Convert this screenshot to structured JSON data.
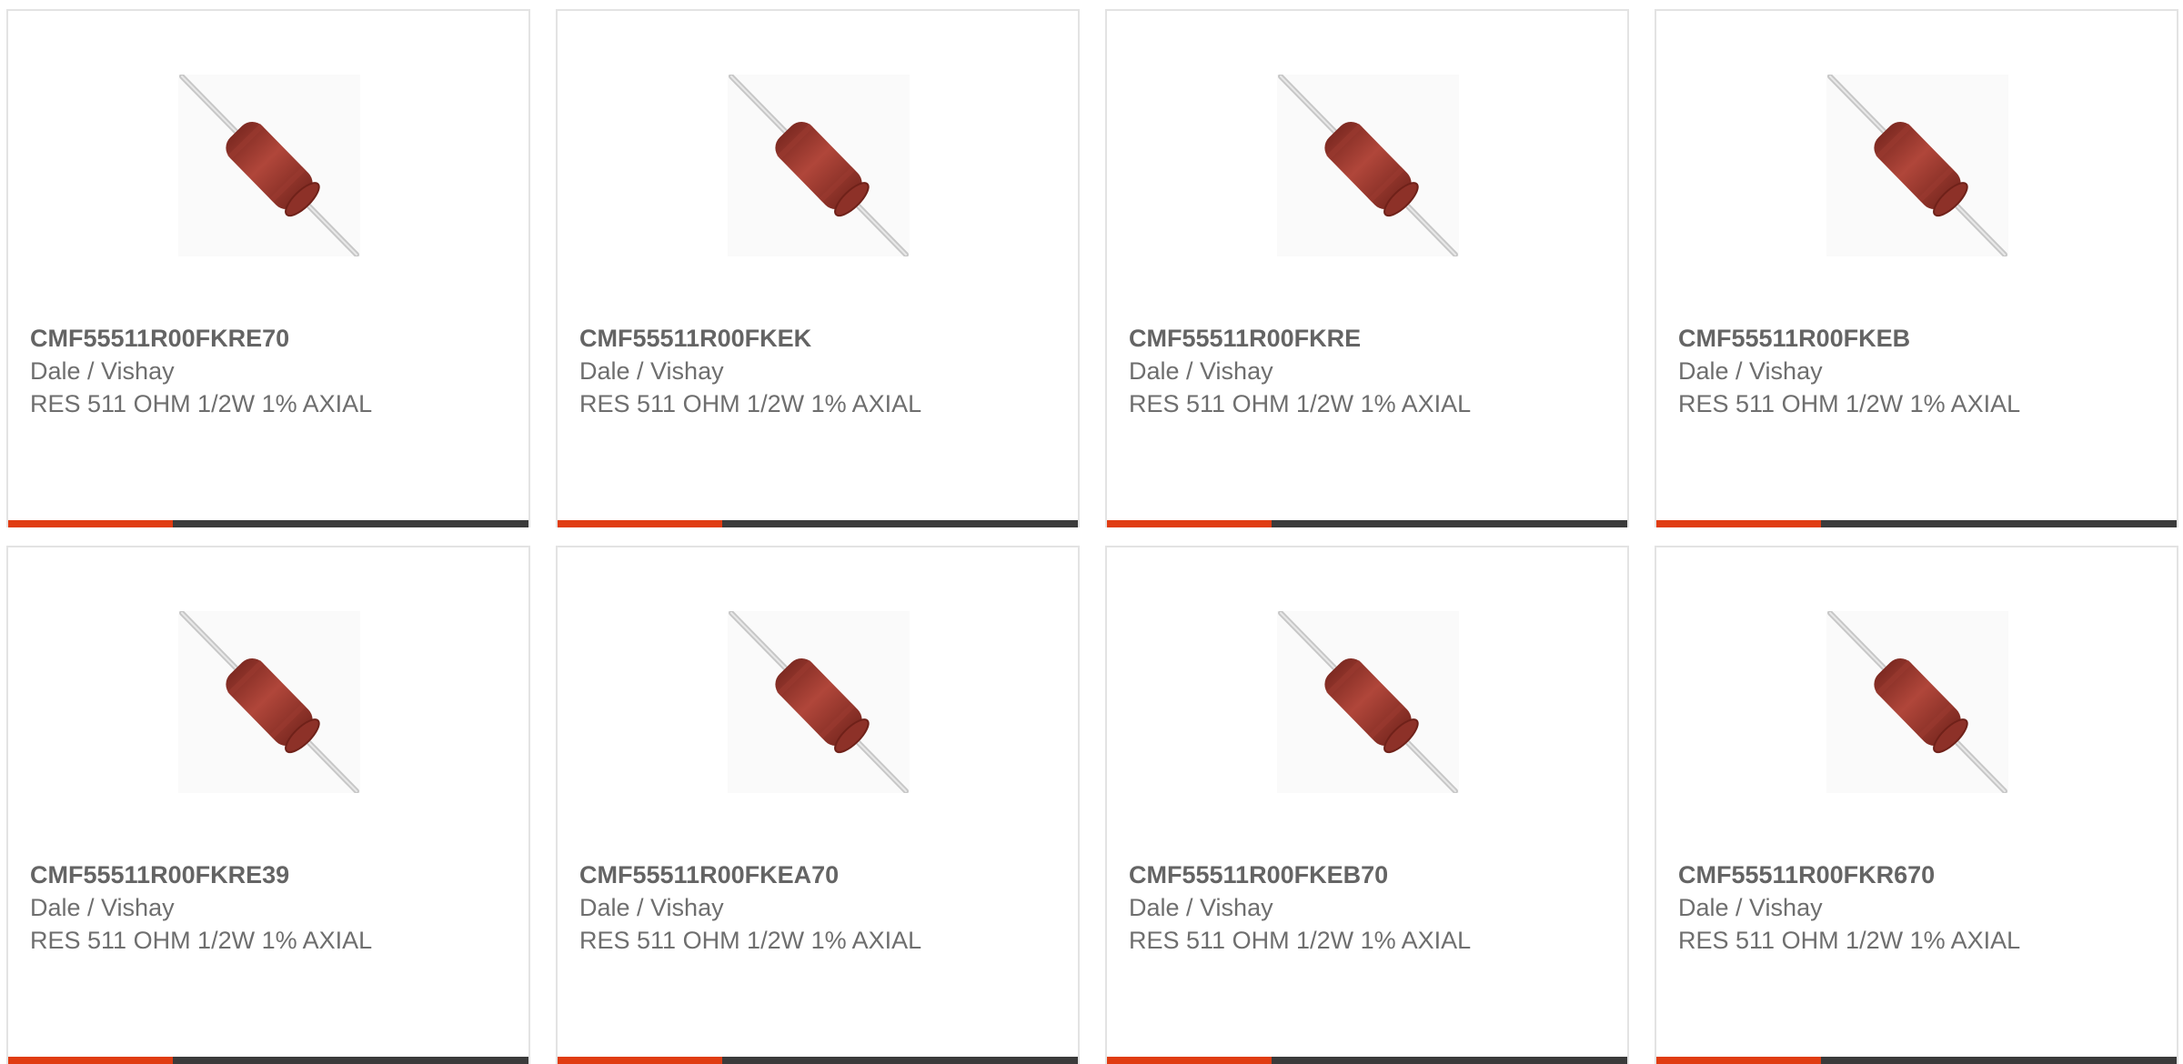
{
  "colors": {
    "accent": "#e03c12",
    "bar": "#3b3b3b",
    "border": "#e3e3e3",
    "resistor_body": "#a3392f",
    "lead_wire": "#c8c8c8"
  },
  "products": [
    {
      "part_number": "CMF55511R00FKRE70",
      "manufacturer": "Dale / Vishay",
      "description": "RES 511 OHM 1/2W 1% AXIAL",
      "image_icon": "axial-resistor-icon"
    },
    {
      "part_number": "CMF55511R00FKEK",
      "manufacturer": "Dale / Vishay",
      "description": "RES 511 OHM 1/2W 1% AXIAL",
      "image_icon": "axial-resistor-icon"
    },
    {
      "part_number": "CMF55511R00FKRE",
      "manufacturer": "Dale / Vishay",
      "description": "RES 511 OHM 1/2W 1% AXIAL",
      "image_icon": "axial-resistor-icon"
    },
    {
      "part_number": "CMF55511R00FKEB",
      "manufacturer": "Dale / Vishay",
      "description": "RES 511 OHM 1/2W 1% AXIAL",
      "image_icon": "axial-resistor-icon"
    },
    {
      "part_number": "CMF55511R00FKRE39",
      "manufacturer": "Dale / Vishay",
      "description": "RES 511 OHM 1/2W 1% AXIAL",
      "image_icon": "axial-resistor-icon"
    },
    {
      "part_number": "CMF55511R00FKEA70",
      "manufacturer": "Dale / Vishay",
      "description": "RES 511 OHM 1/2W 1% AXIAL",
      "image_icon": "axial-resistor-icon"
    },
    {
      "part_number": "CMF55511R00FKEB70",
      "manufacturer": "Dale / Vishay",
      "description": "RES 511 OHM 1/2W 1% AXIAL",
      "image_icon": "axial-resistor-icon"
    },
    {
      "part_number": "CMF55511R00FKR670",
      "manufacturer": "Dale / Vishay",
      "description": "RES 511 OHM 1/2W 1% AXIAL",
      "image_icon": "axial-resistor-icon"
    }
  ]
}
